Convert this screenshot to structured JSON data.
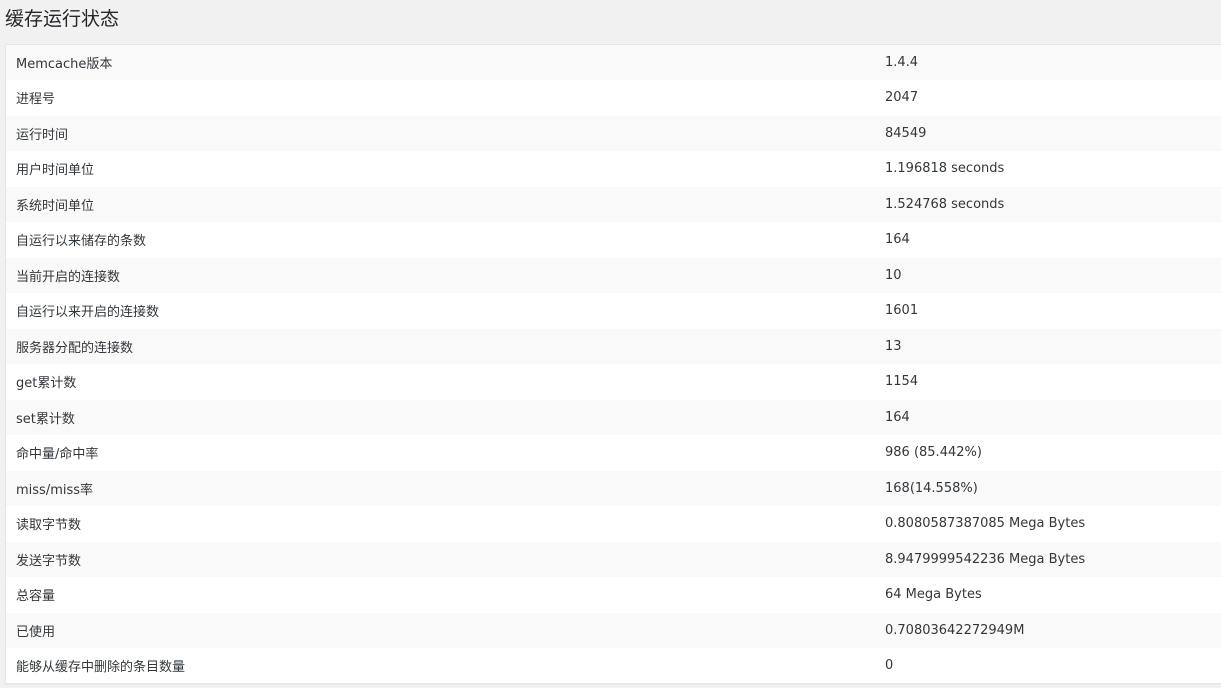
{
  "page": {
    "title": "缓存运行状态"
  },
  "rows": [
    {
      "label": "Memcache版本",
      "value": "1.4.4"
    },
    {
      "label": "进程号",
      "value": "2047"
    },
    {
      "label": "运行时间",
      "value": "84549"
    },
    {
      "label": "用户时间单位",
      "value": "1.196818 seconds"
    },
    {
      "label": "系统时间单位",
      "value": "1.524768 seconds"
    },
    {
      "label": "自运行以来储存的条数",
      "value": "164"
    },
    {
      "label": "当前开启的连接数",
      "value": "10"
    },
    {
      "label": "自运行以来开启的连接数",
      "value": "1601"
    },
    {
      "label": "服务器分配的连接数",
      "value": "13"
    },
    {
      "label": "get累计数",
      "value": "1154"
    },
    {
      "label": "set累计数",
      "value": "164"
    },
    {
      "label": "命中量/命中率",
      "value": "986 (85.442%)"
    },
    {
      "label": "miss/miss率",
      "value": "168(14.558%)"
    },
    {
      "label": "读取字节数",
      "value": "0.8080587387085 Mega Bytes"
    },
    {
      "label": "发送字节数",
      "value": "8.9479999542236 Mega Bytes"
    },
    {
      "label": "总容量",
      "value": "64 Mega Bytes"
    },
    {
      "label": "已使用",
      "value": "0.70803642272949M"
    },
    {
      "label": "能够从缓存中删除的条目数量",
      "value": "0"
    }
  ]
}
